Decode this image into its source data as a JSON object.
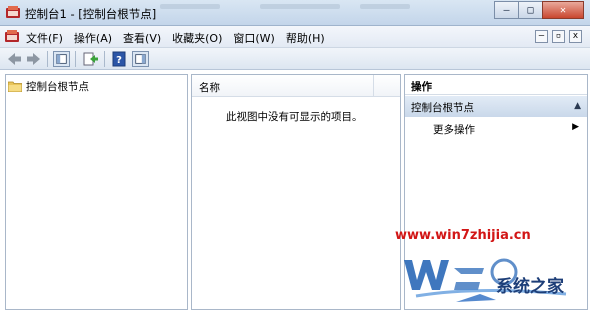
{
  "window": {
    "title": "控制台1 - [控制台根节点]",
    "buttons": {
      "minimize": "—",
      "restore": "□",
      "close": "✕"
    }
  },
  "menubar": {
    "items": [
      "文件(F)",
      "操作(A)",
      "查看(V)",
      "收藏夹(O)",
      "窗口(W)",
      "帮助(H)"
    ],
    "mdi": {
      "minimize": "–",
      "restore": "▫",
      "close": "x"
    }
  },
  "toolbar": {
    "icons": [
      "back-icon",
      "forward-icon",
      "show-hide-tree-icon",
      "export-list-icon",
      "help-icon",
      "show-hide-action-pane-icon"
    ]
  },
  "tree": {
    "root_label": "控制台根节点"
  },
  "list": {
    "column_name": "名称",
    "empty_message": "此视图中没有可显示的项目。"
  },
  "actions": {
    "title": "操作",
    "section_label": "控制台根节点",
    "more_actions": "更多操作"
  },
  "watermark": {
    "url": "www.win7zhijia.cn",
    "site_name": "系统之家"
  },
  "colors": {
    "watermark_red": "#d21616",
    "watermark_blue": "#1d3e78",
    "action_header": "#c9d8ea"
  }
}
